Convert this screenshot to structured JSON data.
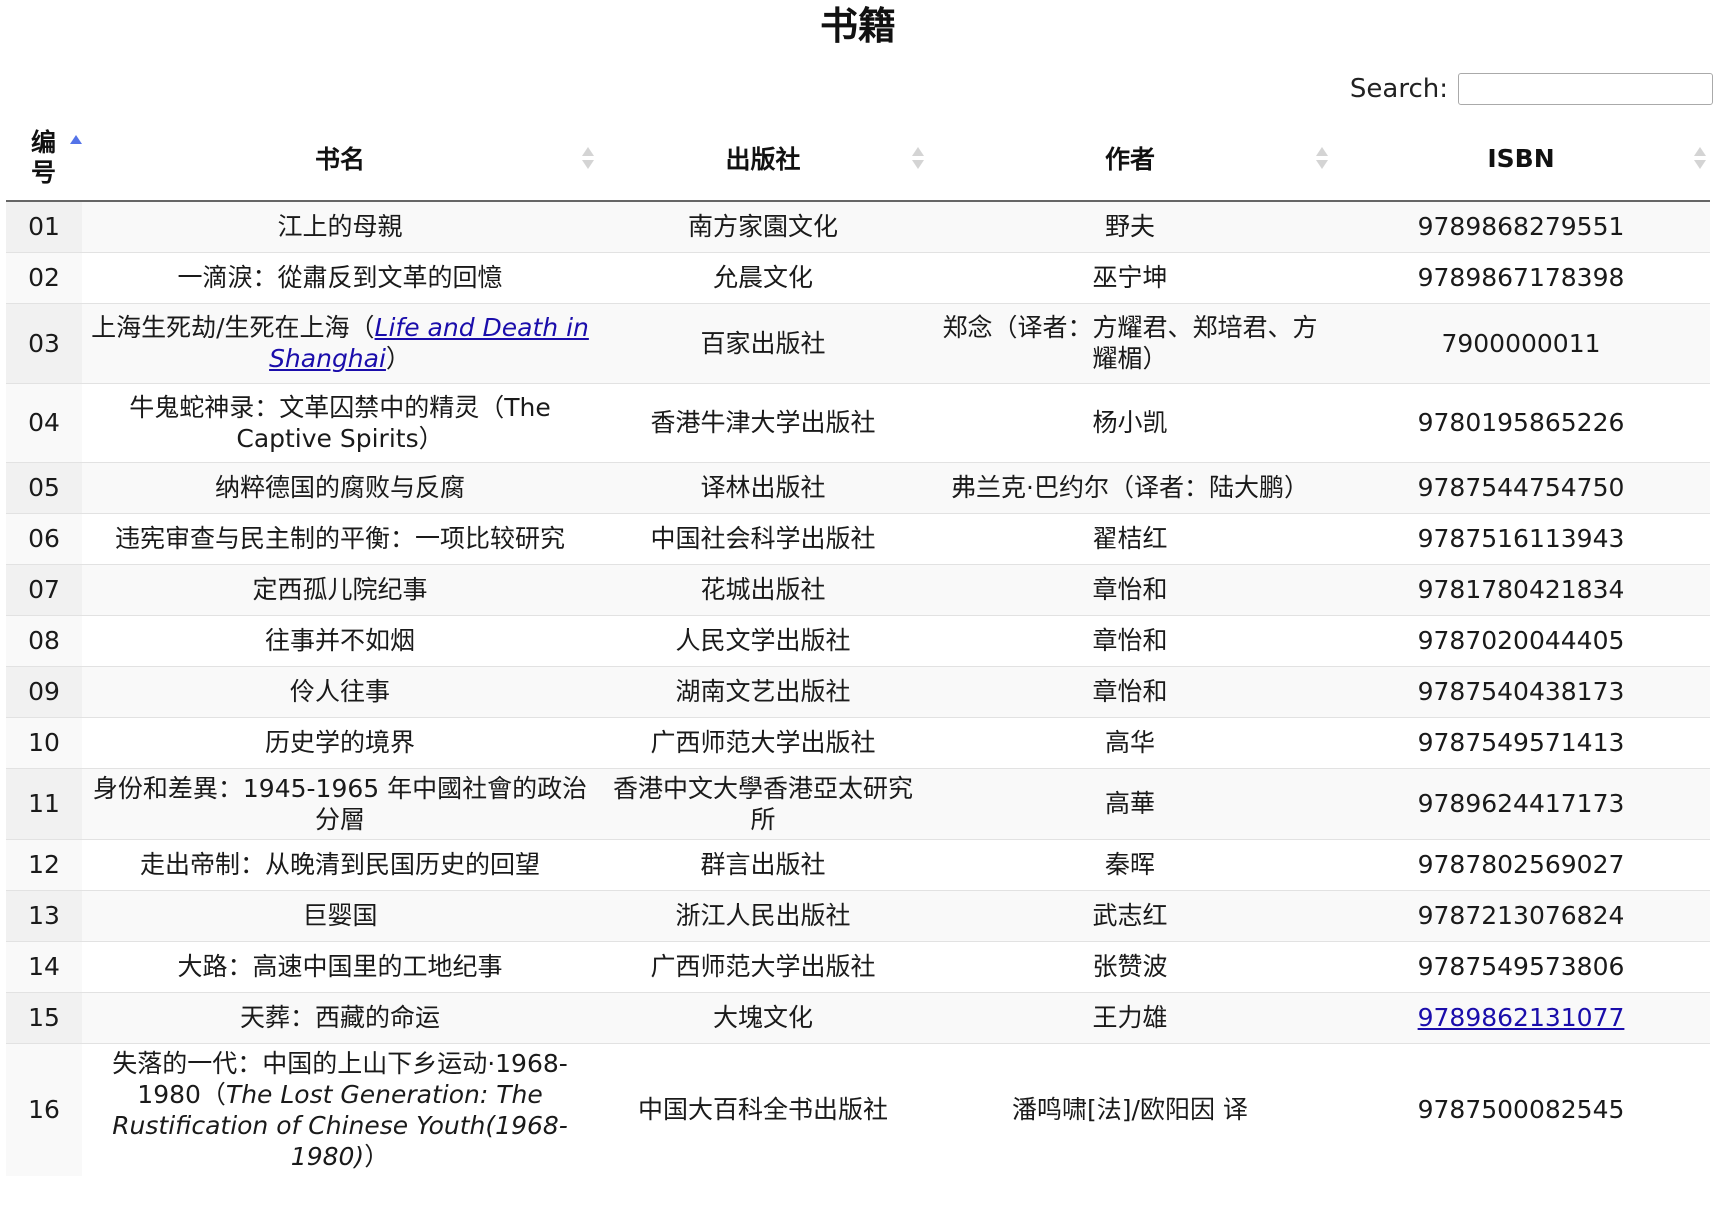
{
  "page": {
    "title": "书籍"
  },
  "search": {
    "label": "Search:",
    "value": ""
  },
  "columns": [
    {
      "label": "编号",
      "sorted": "asc"
    },
    {
      "label": "书名",
      "sorted": "none"
    },
    {
      "label": "出版社",
      "sorted": "none"
    },
    {
      "label": "作者",
      "sorted": "none"
    },
    {
      "label": "ISBN",
      "sorted": "none"
    }
  ],
  "rows": [
    {
      "num": "01",
      "title": "江上的母親",
      "publisher": "南方家園文化",
      "author": "野夫",
      "isbn": "9789868279551"
    },
    {
      "num": "02",
      "title": "一滴淚：從肅反到文革的回憶",
      "publisher": "允晨文化",
      "author": "巫宁坤",
      "isbn": "9789867178398"
    },
    {
      "num": "03",
      "title_pre": "上海生死劫/生死在上海（",
      "title_link": "Life and Death in Shanghai",
      "title_post": "）",
      "publisher": "百家出版社",
      "author": "郑念（译者：方耀君、郑培君、方耀楣）",
      "isbn": "7900000011"
    },
    {
      "num": "04",
      "title": "牛鬼蛇神录：文革囚禁中的精灵（The Captive Spirits）",
      "publisher": "香港牛津大学出版社",
      "author": "杨小凯",
      "isbn": "9780195865226"
    },
    {
      "num": "05",
      "title": "纳粹德国的腐败与反腐",
      "publisher": "译林出版社",
      "author": "弗兰克·巴约尔（译者：陆大鹏）",
      "isbn": "9787544754750"
    },
    {
      "num": "06",
      "title": "违宪审查与民主制的平衡：一项比较研究",
      "publisher": "中国社会科学出版社",
      "author": "翟桔红",
      "isbn": "9787516113943"
    },
    {
      "num": "07",
      "title": "定西孤儿院纪事",
      "publisher": "花城出版社",
      "author": "章怡和",
      "isbn": "9781780421834"
    },
    {
      "num": "08",
      "title": "往事并不如烟",
      "publisher": "人民文学出版社",
      "author": "章怡和",
      "isbn": "9787020044405"
    },
    {
      "num": "09",
      "title": "伶人往事",
      "publisher": "湖南文艺出版社",
      "author": "章怡和",
      "isbn": "9787540438173"
    },
    {
      "num": "10",
      "title": "历史学的境界",
      "publisher": "广西师范大学出版社",
      "author": "高华",
      "isbn": "9787549571413"
    },
    {
      "num": "11",
      "title": "身份和差異：1945-1965 年中國社會的政治分層",
      "publisher": "香港中文大學香港亞太研究所",
      "author": "高華",
      "isbn": "9789624417173"
    },
    {
      "num": "12",
      "title": "走出帝制：从晚清到民国历史的回望",
      "publisher": "群言出版社",
      "author": "秦晖",
      "isbn": "9787802569027"
    },
    {
      "num": "13",
      "title": "巨婴国",
      "publisher": "浙江人民出版社",
      "author": "武志红",
      "isbn": "9787213076824"
    },
    {
      "num": "14",
      "title": "大路：高速中国里的工地纪事",
      "publisher": "广西师范大学出版社",
      "author": "张赞波",
      "isbn": "9787549573806"
    },
    {
      "num": "15",
      "title": "天葬：西藏的命运",
      "publisher": "大塊文化",
      "author": "王力雄",
      "isbn": "9789862131077",
      "isbn_is_link": true
    },
    {
      "num": "16",
      "title_pre": "失落的一代：中国的上山下乡运动·1968-1980（",
      "title_italic": "The Lost Generation: The Rustification of Chinese Youth(1968-1980)",
      "title_post": "）",
      "publisher": "中国大百科全书出版社",
      "author": "潘鸣啸[法]/欧阳因 译",
      "isbn": "9787500082545"
    }
  ]
}
